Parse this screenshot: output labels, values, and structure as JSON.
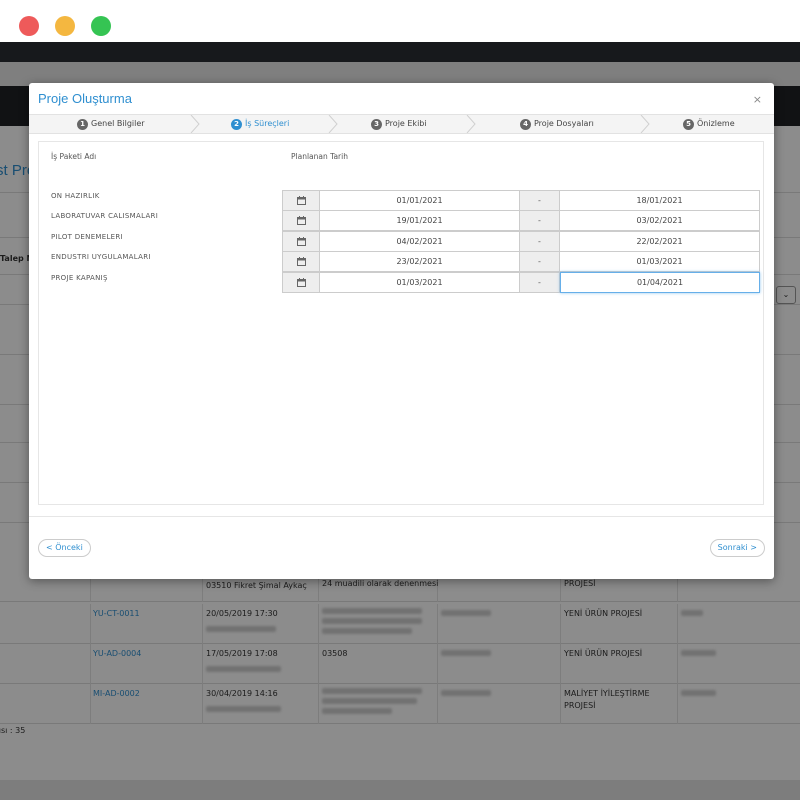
{
  "colors": {
    "accent": "#2f8fd0",
    "overlay": "rgba(0,0,0,0.45)",
    "focus": "#66afe9"
  },
  "background_app": {
    "page_title": "st Pro",
    "table_header_partial": "Talep N",
    "select_chevron": "⌄",
    "rows": [
      {
        "code": "",
        "date": "03510 Fikret Şimal Aykaç",
        "desc": "24 muadili olarak denenmesi",
        "type": "PROJESİ"
      },
      {
        "code": "YU-CT-0011",
        "date": "20/05/2019 17:30",
        "desc": "",
        "type": "YENİ ÜRÜN PROJESİ"
      },
      {
        "code": "YU-AD-0004",
        "date": "17/05/2019 17:08",
        "desc": "03508",
        "type": "YENİ ÜRÜN PROJESİ"
      },
      {
        "code": "MI-AD-0002",
        "date": "30/04/2019 14:16",
        "desc": "",
        "type": "MALİYET İYİLEŞTİRME PROJESİ"
      }
    ],
    "footer_count": "yısı : 35"
  },
  "modal": {
    "title": "Proje Oluşturma",
    "close_icon": "×",
    "steps": [
      {
        "num": "1",
        "label": "Genel Bilgiler"
      },
      {
        "num": "2",
        "label": "İş Süreçleri"
      },
      {
        "num": "3",
        "label": "Proje Ekibi"
      },
      {
        "num": "4",
        "label": "Proje Dosyaları"
      },
      {
        "num": "5",
        "label": "Önizleme"
      }
    ],
    "col_workpackage": "İş Paketi Adı",
    "col_planned_date": "Planlanan Tarih",
    "work_packages": [
      {
        "name": "ON HAZIRLIK",
        "start": "01/01/2021",
        "end": "18/01/2021"
      },
      {
        "name": "LABORATUVAR CALISMALARI",
        "start": "19/01/2021",
        "end": "03/02/2021"
      },
      {
        "name": "PILOT DENEMELERI",
        "start": "04/02/2021",
        "end": "22/02/2021"
      },
      {
        "name": "ENDUSTRI UYGULAMALARI",
        "start": "23/02/2021",
        "end": "01/03/2021"
      },
      {
        "name": "PROJE KAPANIŞ",
        "start": "01/03/2021",
        "end": "01/04/2021"
      }
    ],
    "range_separator": "-",
    "prev_button": "< Önceki",
    "next_button": "Sonraki >"
  }
}
